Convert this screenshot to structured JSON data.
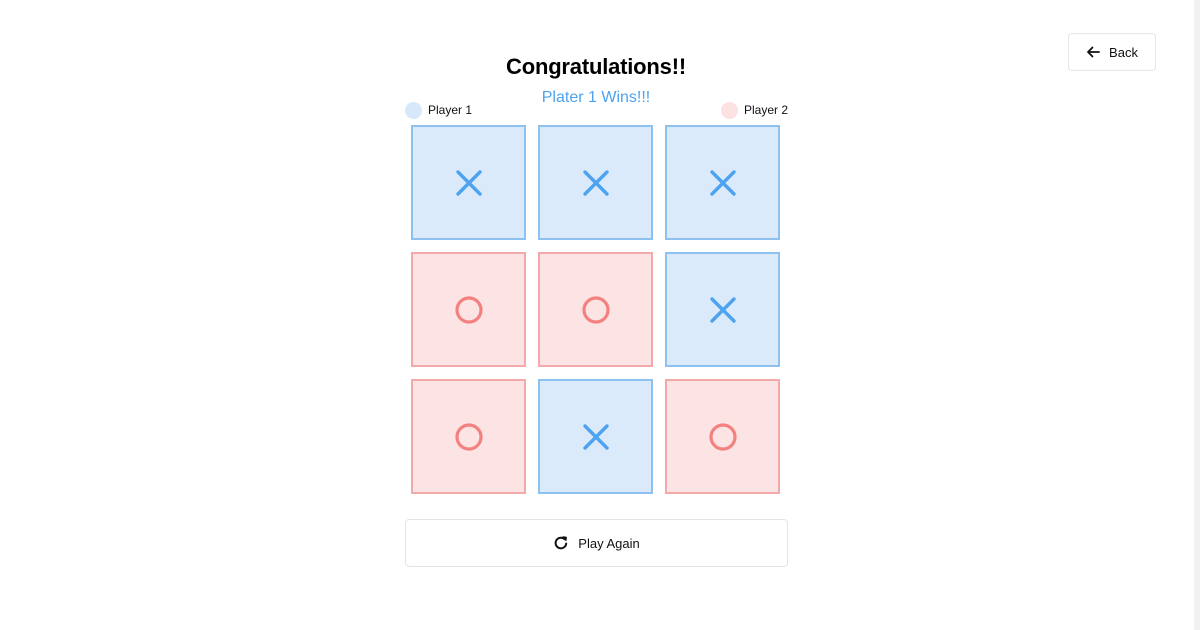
{
  "header": {
    "back_label": "Back",
    "back_icon": "arrow-left-icon"
  },
  "result": {
    "title": "Congratulations!!",
    "subtitle": "Plater 1 Wins!!!"
  },
  "legend": {
    "player1": {
      "label": "Player 1",
      "color": "#d7e8fb"
    },
    "player2": {
      "label": "Player 2",
      "color": "#fde2e2"
    }
  },
  "board": {
    "cells": [
      "X",
      "X",
      "X",
      "O",
      "O",
      "X",
      "O",
      "X",
      "O"
    ],
    "x_color": "#4da3f0",
    "o_color": "#f3817f",
    "x_background": "#dbeafa",
    "o_background": "#fde4e4"
  },
  "actions": {
    "play_again_label": "Play Again",
    "play_again_icon": "refresh-icon"
  }
}
